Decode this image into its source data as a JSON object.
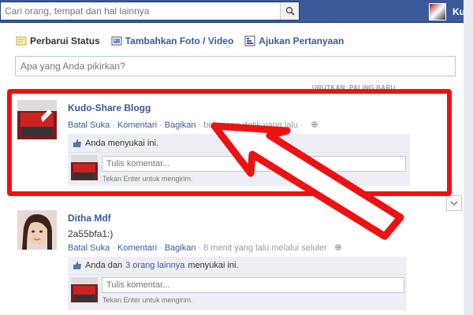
{
  "search": {
    "placeholder": "Cari orang, tempat dan hal lainnya"
  },
  "topbar": {
    "user_name": "Kud"
  },
  "composer": {
    "tabs": [
      {
        "label": "Perbarui Status",
        "icon": "status-icon"
      },
      {
        "label": "Tambahkan Foto / Video",
        "icon": "photo-icon"
      },
      {
        "label": "Ajukan Pertanyaan",
        "icon": "question-icon"
      }
    ],
    "placeholder": "Apa yang Anda pikirkan?"
  },
  "sort": {
    "label": "URUTKAN: PALING BARU"
  },
  "stories": [
    {
      "author": "Kudo-Share Blogg",
      "actions": [
        "Batal Suka",
        "Komentari",
        "Bagikan"
      ],
      "time": "beberapa detik yang lalu",
      "likes_text": "Anda menyukai ini.",
      "comment_placeholder": "Tulis komentar...",
      "hint": "Tekan Enter untuk mengirim."
    },
    {
      "author": "Ditha Mdf",
      "text": "2a55bfa1:)",
      "actions": [
        "Batal Suka",
        "Komentari",
        "Bagikan"
      ],
      "time": "6 menit yang lalu melalui seluler",
      "likes_prefix": "Anda dan",
      "likes_link": "3 orang lainnya",
      "likes_suffix": "menyukai ini.",
      "comment_placeholder": "Tulis komentar...",
      "hint": "Tekan Enter untuk mengirim."
    }
  ],
  "colors": {
    "brand": "#3b5998",
    "highlight": "#ee1111",
    "ufi_bg": "#edeff4"
  }
}
